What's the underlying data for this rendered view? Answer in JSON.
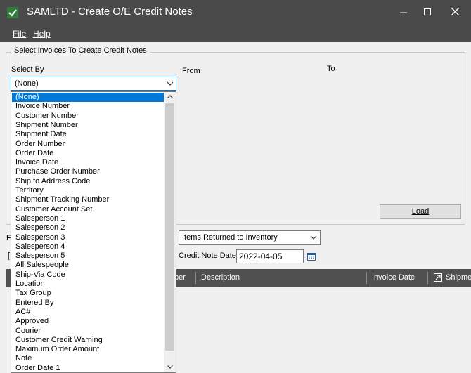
{
  "window": {
    "title": "SAMLTD - Create O/E Credit Notes"
  },
  "menu": {
    "file": "File",
    "help": "Help"
  },
  "selection": {
    "group_title": "Select Invoices To Create Credit Notes",
    "select_by_label": "Select By",
    "from_label": "From",
    "to_label": "To",
    "select_by_value": "(None)",
    "options": [
      "(None)",
      "Invoice Number",
      "Customer Number",
      "Shipment Number",
      "Shipment Date",
      "Order Number",
      "Order Date",
      "Invoice Date",
      "Purchase Order Number",
      "Ship to Address Code",
      "Territory",
      "Shipment Tracking Number",
      "Customer Account Set",
      "Salesperson 1",
      "Salesperson 2",
      "Salesperson 3",
      "Salesperson 4",
      "Salesperson 5",
      "All Salespeople",
      "Ship-Via Code",
      "Location",
      "Tax Group",
      "Entered By",
      "AC#",
      "Approved",
      "Courier",
      "Customer Credit Warning",
      "Maximum Order Amount",
      "Note",
      "Order Date 1"
    ],
    "selected_index": 0,
    "load_label": "Load"
  },
  "options": {
    "returned_value": "Items Returned to Inventory",
    "credit_note_date_label": "Credit Note Date",
    "credit_note_date": "2022-04-05",
    "partial_label_1": "F",
    "partial_label_2": "["
  },
  "grid": {
    "columns": [
      "ber",
      "Description",
      "Invoice Date",
      "Shipmer"
    ]
  }
}
